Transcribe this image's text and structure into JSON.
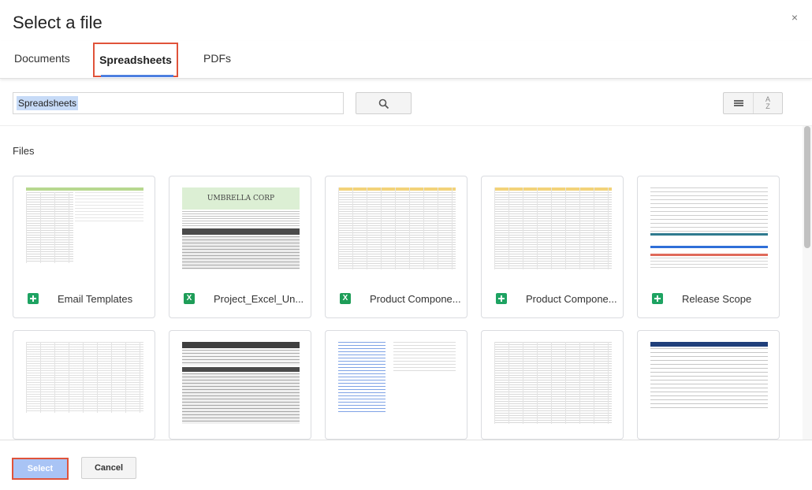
{
  "dialog": {
    "title": "Select a file",
    "close_glyph": "×"
  },
  "tabs": [
    {
      "label": "Documents",
      "selected": false
    },
    {
      "label": "Spreadsheets",
      "selected": true
    },
    {
      "label": "PDFs",
      "selected": false
    }
  ],
  "search": {
    "value": "Spreadsheets",
    "icon": "search-icon"
  },
  "view": {
    "list_icon": "list-view-icon",
    "sort_icon": "sort-az-icon",
    "sort_glyph_top": "A",
    "sort_glyph_bottom": "Z"
  },
  "files_label": "Files",
  "files": [
    {
      "name": "Email Templates",
      "type": "sheets",
      "icon_text": ""
    },
    {
      "name": "Project_Excel_Un...",
      "type": "excel",
      "icon_text": "X"
    },
    {
      "name": "Product Compone...",
      "type": "excel",
      "icon_text": "X"
    },
    {
      "name": "Product Compone...",
      "type": "sheets",
      "icon_text": ""
    },
    {
      "name": "Release Scope",
      "type": "sheets",
      "icon_text": ""
    }
  ],
  "thumbnail_text": {
    "umbrella": "UMBRELLA CORP"
  },
  "footer": {
    "select_label": "Select",
    "cancel_label": "Cancel"
  },
  "colors": {
    "accent_blue": "#4d7fe0",
    "highlight_red": "#e0533a",
    "sheets_green": "#1ea362",
    "select_disabled": "#a9c4f5"
  }
}
